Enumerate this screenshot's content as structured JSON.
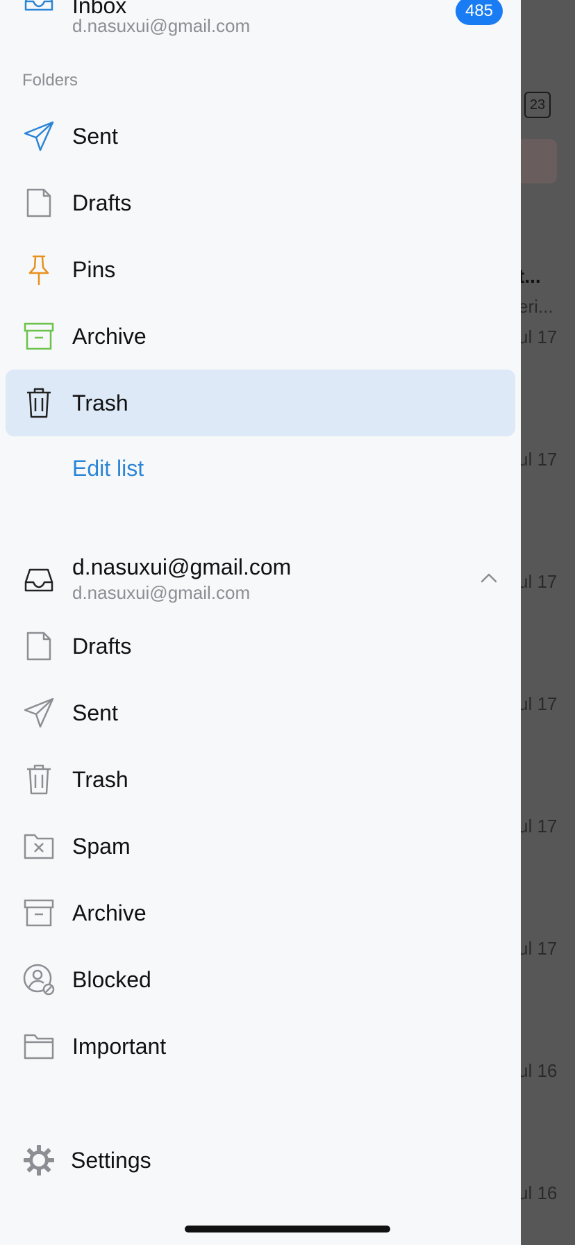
{
  "background": {
    "calendar_day": "23",
    "truncated_bold": "t...",
    "truncated_sub": "eri...",
    "dates": [
      "ul 17",
      "ul 17",
      "ul 17",
      "ul 17",
      "ul 17",
      "ul 17",
      "ul 16",
      "ul 16"
    ]
  },
  "inbox": {
    "title": "Inbox",
    "email": "d.nasuxui@gmail.com",
    "badge": "485"
  },
  "folders": {
    "section_title": "Folders",
    "items": [
      {
        "label": "Sent",
        "icon": "send-icon",
        "color": "#2b85d6"
      },
      {
        "label": "Drafts",
        "icon": "draft-icon",
        "color": "#8b8e93"
      },
      {
        "label": "Pins",
        "icon": "pin-icon",
        "color": "#e8911c"
      },
      {
        "label": "Archive",
        "icon": "archive-icon",
        "color": "#6cc24a"
      },
      {
        "label": "Trash",
        "icon": "trash-icon",
        "color": "#333333",
        "selected": true
      }
    ],
    "edit_label": "Edit list"
  },
  "account": {
    "title": "d.nasuxui@gmail.com",
    "email": "d.nasuxui@gmail.com",
    "items": [
      {
        "label": "Drafts",
        "icon": "draft-icon"
      },
      {
        "label": "Sent",
        "icon": "send-icon"
      },
      {
        "label": "Trash",
        "icon": "trash-icon"
      },
      {
        "label": "Spam",
        "icon": "spam-icon"
      },
      {
        "label": "Archive",
        "icon": "archive-icon"
      },
      {
        "label": "Blocked",
        "icon": "blocked-user-icon"
      },
      {
        "label": "Important",
        "icon": "folder-icon"
      }
    ]
  },
  "settings": {
    "label": "Settings",
    "icon": "gear-icon"
  },
  "colors": {
    "accent": "#1a7cf2",
    "selected_bg": "#dde9f7",
    "muted": "#8b8e93"
  }
}
